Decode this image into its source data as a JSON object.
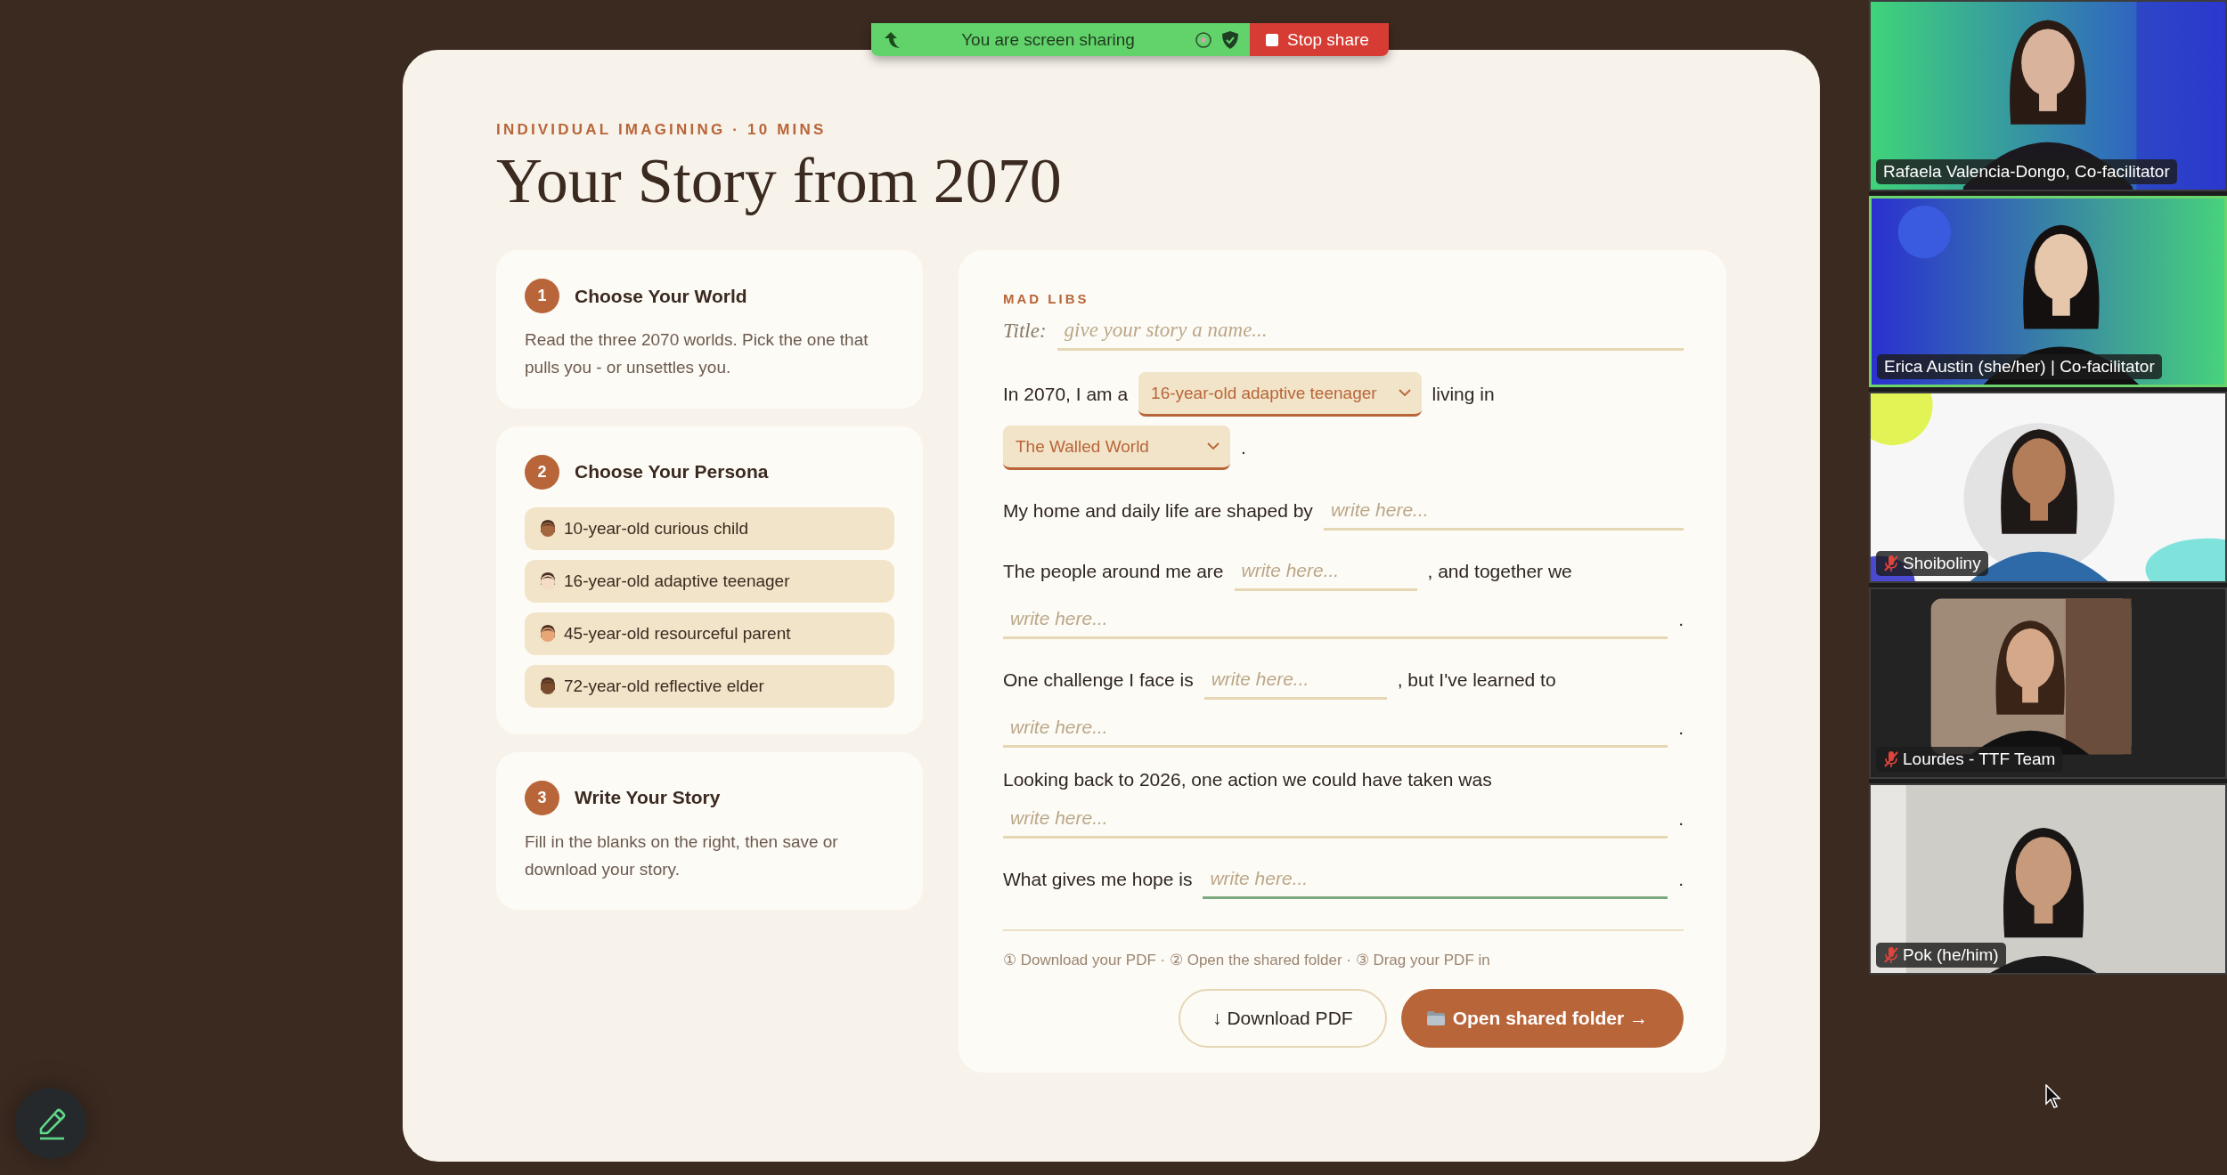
{
  "share_bar": {
    "status": "You are screen sharing",
    "stop_button": "Stop share"
  },
  "page": {
    "eyebrow": "INDIVIDUAL IMAGINING · 10 MINS",
    "title": "Your Story from 2070",
    "steps": [
      {
        "number": "1",
        "title": "Choose Your World",
        "text": "Read the three 2070 worlds. Pick the one that pulls you - or unsettles you."
      },
      {
        "number": "2",
        "title": "Choose Your Persona",
        "personas": [
          {
            "label": "10-year-old curious child",
            "color": "#a5673f"
          },
          {
            "label": "16-year-old adaptive teenager",
            "color": "#f4dcc6"
          },
          {
            "label": "45-year-old resourceful parent",
            "color": "#e6a676"
          },
          {
            "label": "72-year-old reflective elder",
            "color": "#7b4b2d"
          }
        ]
      },
      {
        "number": "3",
        "title": "Write Your Story",
        "text": "Fill in the blanks on the right, then save or download your story."
      }
    ]
  },
  "mad_libs": {
    "heading": "MAD LIBS",
    "title_label": "Title:",
    "title_placeholder": "give your story a name...",
    "lines": [
      {
        "parts": [
          {
            "kind": "text",
            "text": "In 2070, I am a"
          },
          {
            "kind": "select",
            "value": "16-year-old adaptive teenager"
          },
          {
            "kind": "text",
            "text": "living in"
          },
          {
            "kind": "select",
            "value": "The Walled World"
          },
          {
            "kind": "text",
            "text": "."
          }
        ]
      },
      {
        "parts": [
          {
            "kind": "text",
            "text": "My home and daily life are shaped by"
          },
          {
            "kind": "fill_blank",
            "placeholder": "write here...",
            "focused": false
          }
        ]
      },
      {
        "parts": [
          {
            "kind": "text",
            "text": "The people around me are"
          },
          {
            "kind": "short_blank",
            "placeholder": "write here...",
            "focused": false
          },
          {
            "kind": "text",
            "text": ", and together we"
          },
          {
            "kind": "line_blank",
            "placeholder": "write here...",
            "focused": false
          },
          {
            "kind": "text",
            "text": "."
          }
        ]
      },
      {
        "parts": [
          {
            "kind": "text",
            "text": "One challenge I face is"
          },
          {
            "kind": "short_blank",
            "placeholder": "write here...",
            "focused": false
          },
          {
            "kind": "text",
            "text": ", but I've learned to"
          },
          {
            "kind": "line_blank",
            "placeholder": "write here...",
            "focused": false
          },
          {
            "kind": "text",
            "text": "."
          }
        ]
      },
      {
        "parts": [
          {
            "kind": "text",
            "text": "Looking back to 2026, one action we could have taken was"
          },
          {
            "kind": "line_blank",
            "placeholder": "write here...",
            "focused": false
          },
          {
            "kind": "text",
            "text": "."
          }
        ]
      },
      {
        "parts": [
          {
            "kind": "text",
            "text": "What gives me hope is"
          },
          {
            "kind": "fill_blank",
            "placeholder": "write here...",
            "focused": true
          },
          {
            "kind": "text",
            "text": "."
          }
        ]
      }
    ],
    "steps_hint": "① Download your PDF · ② Open the shared folder · ③ Drag your PDF in",
    "buttons": [
      {
        "kind": "outline",
        "label": "↓ Download PDF"
      },
      {
        "kind": "primary",
        "label": "Open shared folder →"
      }
    ]
  },
  "participants": [
    {
      "name": "Rafaela Valencia-Dongo, Co-facilitator",
      "muted": false,
      "speaking": false
    },
    {
      "name": "Erica Austin (she/her) | Co-facilitator",
      "muted": false,
      "speaking": true
    },
    {
      "name": "Shoiboliny",
      "muted": true,
      "speaking": false
    },
    {
      "name": "Lourdes - TTF Team",
      "muted": true,
      "speaking": false
    },
    {
      "name": "Pok (he/him)",
      "muted": true,
      "speaking": false
    }
  ]
}
